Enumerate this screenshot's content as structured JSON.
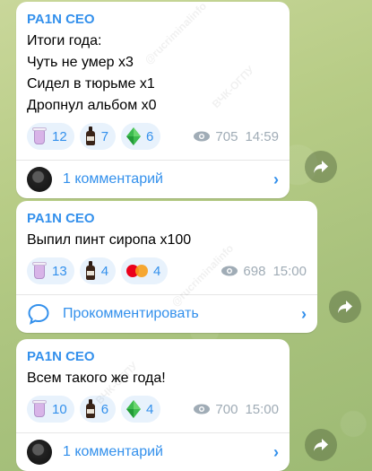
{
  "posts": [
    {
      "author": "PA1N CEO",
      "text": "Итоги года:\nЧуть не умер х3\nСидел в тюрьме х1\nДропнул альбом х0",
      "reactions": [
        {
          "icon": "lean-cup-icon",
          "count": "12"
        },
        {
          "icon": "syrup-bottle-icon",
          "count": "7"
        },
        {
          "icon": "green-diamond-icon",
          "count": "6"
        }
      ],
      "views": "705",
      "time": "14:59",
      "comments_label": "1 комментарий"
    },
    {
      "author": "PA1N CEO",
      "text": "Выпил пинт сиропа х100",
      "reactions": [
        {
          "icon": "lean-cup-icon",
          "count": "13"
        },
        {
          "icon": "syrup-bottle-icon",
          "count": "4"
        },
        {
          "icon": "mastercard-icon",
          "count": "4"
        }
      ],
      "views": "698",
      "time": "15:00",
      "comments_label": "Прокомментировать"
    },
    {
      "author": "PA1N CEO",
      "text": "Всем такого же года!",
      "reactions": [
        {
          "icon": "lean-cup-icon",
          "count": "10"
        },
        {
          "icon": "syrup-bottle-icon",
          "count": "6"
        },
        {
          "icon": "green-diamond-icon",
          "count": "4"
        }
      ],
      "views": "700",
      "time": "15:00",
      "comments_label": "1 комментарий"
    }
  ],
  "watermark": "@rucriminalinfo",
  "watermark2": "ВЧК-ОГПУ",
  "colors": {
    "accent": "#3390ec",
    "meta": "#a0acb6",
    "reaction_bg": "#e8f2fc"
  }
}
